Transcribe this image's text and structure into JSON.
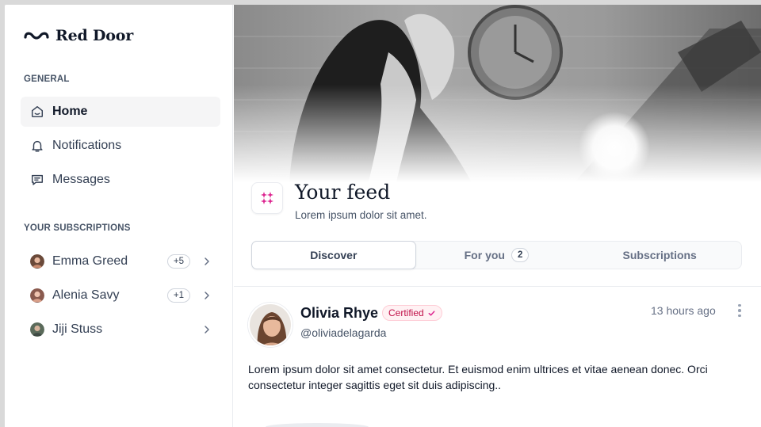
{
  "brand": {
    "name": "Red Door"
  },
  "sidebar": {
    "general_label": "GENERAL",
    "nav": [
      {
        "label": "Home",
        "icon": "home-icon",
        "active": true
      },
      {
        "label": "Notifications",
        "icon": "bell-icon",
        "active": false
      },
      {
        "label": "Messages",
        "icon": "message-icon",
        "active": false
      }
    ],
    "subs_label": "YOUR SUBSCRIPTIONS",
    "subscriptions": [
      {
        "name": "Emma Greed",
        "badge": "+5"
      },
      {
        "name": "Alenia Savy",
        "badge": "+1"
      },
      {
        "name": "Jiji Stuss",
        "badge": ""
      }
    ]
  },
  "feed": {
    "title": "Your feed",
    "subtitle": "Lorem ipsum dolor sit amet.",
    "tabs": [
      {
        "label": "Discover",
        "active": true,
        "count": ""
      },
      {
        "label": "For you",
        "active": false,
        "count": "2"
      },
      {
        "label": "Subscriptions",
        "active": false,
        "count": ""
      }
    ]
  },
  "post": {
    "author_name": "Olivia Rhye",
    "badge": "Certified",
    "handle": "@oliviadelagarda",
    "time": "13 hours ago",
    "body": "Lorem ipsum dolor sit amet consectetur. Et euismod enim ultrices et vitae aenean donec. Orci consectetur integer sagittis eget sit duis adipiscing.."
  },
  "colors": {
    "accent": "#dd2590",
    "badge_text": "#c01048",
    "active_bg": "#f5f5f6"
  }
}
